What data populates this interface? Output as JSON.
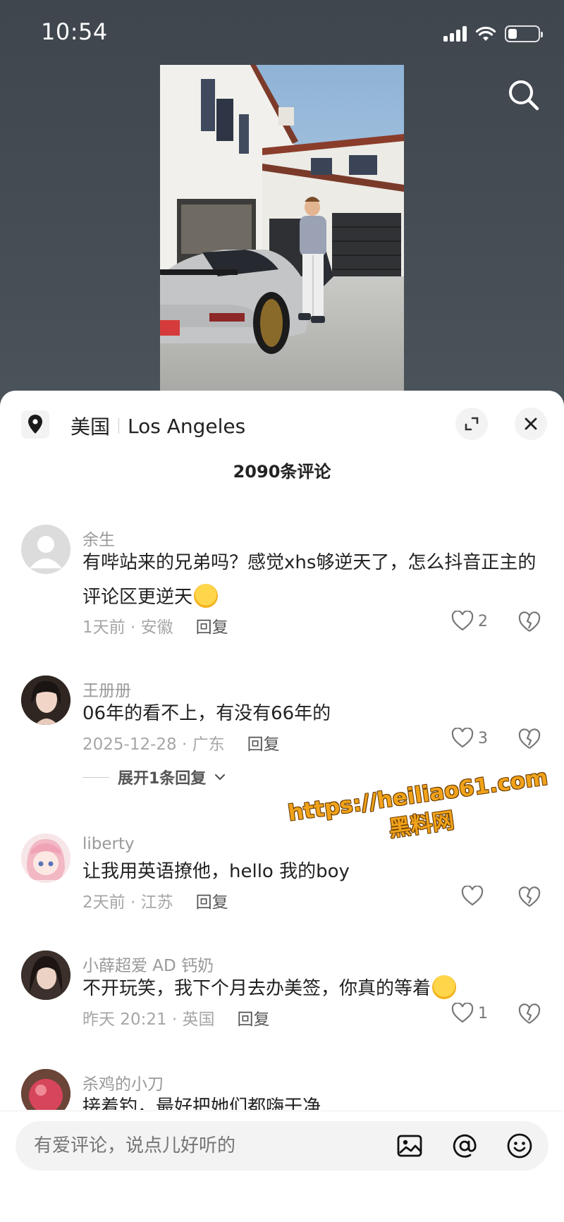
{
  "status_bar": {
    "time": "10:54"
  },
  "sheet": {
    "location_country": "美国",
    "location_city": "Los Angeles",
    "comment_count": "2090条评论"
  },
  "comments": [
    {
      "name": "余生",
      "text": "有哔站来的兄弟吗？感觉xhs够逆天了，怎么抖音正主的评论区更逆天",
      "time_location": "1天前 · 安徽",
      "reply": "回复",
      "likes": "2"
    },
    {
      "name": "王册册",
      "text": "06年的看不上，有没有66年的",
      "time_location": "2025-12-28 · 广东",
      "reply": "回复",
      "likes": "3",
      "expand_replies": "展开1条回复"
    },
    {
      "name": "liberty",
      "text": "让我用英语撩他，hello 我的boy",
      "time_location": "2天前 · 江苏",
      "reply": "回复",
      "likes": ""
    },
    {
      "name": "小薛超爱 AD 钙奶",
      "text": "不开玩笑，我下个月去办美签，你真的等着",
      "time_location": "昨天 20:21 · 英国",
      "reply": "回复",
      "likes": "1"
    },
    {
      "name": "杀鸡的小刀",
      "text": "接着钓，最好把她们都嗨干净"
    }
  ],
  "watermark": {
    "line1": "https://heiliao61.com",
    "line2": "黑料网"
  },
  "input": {
    "placeholder": "有爱评论，说点儿好听的"
  },
  "icons": {
    "search": "search-icon",
    "location": "location-pin-icon",
    "expand": "expand-icon",
    "close": "close-icon",
    "like": "heart-icon",
    "dislike": "broken-heart-icon",
    "image": "image-icon",
    "mention": "at-icon",
    "emoji": "emoji-icon"
  },
  "colors": {
    "watermark": "#f0a21a",
    "sheet_bg": "#ffffff",
    "backdrop": "#4b525a"
  }
}
